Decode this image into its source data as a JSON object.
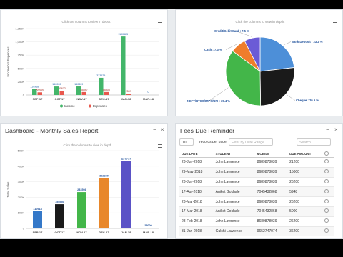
{
  "hint": "Click the columns to view in depth.",
  "income_chart": {
    "chart_data": {
      "type": "bar",
      "categories": [
        "SEP-17",
        "OCT-17",
        "NOV-17",
        "DEC-17",
        "JAN-18",
        "MAR-18"
      ],
      "series": [
        {
          "name": "Income",
          "color": "#43b66a",
          "values": [
            110918,
            160000,
            160809,
            323529,
            1100525,
            0
          ]
        },
        {
          "name": "Expenses",
          "color": "#e8584d",
          "values": [
            50000,
            80672,
            55597,
            55808,
            25000,
            0
          ]
        }
      ],
      "data_labels": {
        "income": [
          "110918",
          "160000",
          "160809",
          "323529",
          "1100525",
          ""
        ],
        "expenses": [
          "50000",
          "80672",
          "55597",
          "55808",
          "250?",
          ""
        ],
        "extra": "0"
      },
      "yticks": [
        "1,250K",
        "1,000K",
        "750K",
        "500K",
        "250K",
        "0"
      ],
      "ylabel": "Income Vs Expenses",
      "xlabel": "",
      "title": ""
    }
  },
  "pie_chart": {
    "chart_data": {
      "type": "pie",
      "slices": [
        {
          "name": "Bank Deposit",
          "value": 23.2,
          "color": "#4d8fd8",
          "label": "Bank Deposit : 23.2 %"
        },
        {
          "name": "Cheque",
          "value": 26.6,
          "color": "#1a1a1a",
          "label": "Cheque : 26.6 %"
        },
        {
          "name": "NEFT/RTGS/IMPS/UPI",
          "value": 35.4,
          "color": "#43b649",
          "label": "NEFT/RTGS/IMPS/UPI : 35.4 %"
        },
        {
          "name": "Cash",
          "value": 7.3,
          "color": "#ef7d2b",
          "label": "Cash : 7.3 %"
        },
        {
          "name": "Credit/Debit Card",
          "value": 7.5,
          "color": "#6b5bd6",
          "label": "Credit/Debit Card : 7.5 %"
        }
      ],
      "title": ""
    }
  },
  "sales_panel": {
    "title": "Dashboard - Monthly Sales Report",
    "minimize": "−",
    "close": "×",
    "chart_data": {
      "type": "bar",
      "categories": [
        "SEP-17",
        "OCT-17",
        "NOV-17",
        "DEC-17",
        "JAN-18",
        "MAR-18"
      ],
      "values": [
        110918,
        155550,
        233508,
        322320,
        432000,
        0
      ],
      "colors": [
        "#3478c8",
        "#1a1a1a",
        "#43b649",
        "#e8872b",
        "#5a52c6",
        "#6a5acd"
      ],
      "data_labels": [
        "110918",
        "155550",
        "233508",
        "322320",
        "4?????",
        "25000"
      ],
      "yticks": [
        "500K",
        "400K",
        "300K",
        "200K",
        "100K",
        "0"
      ],
      "ylabel": "Total Sales",
      "xlabel": "",
      "title": ""
    }
  },
  "fees_panel": {
    "title": "Fees Due Reminder",
    "minimize": "−",
    "close": "×",
    "show_value": "10",
    "records_label": "records per page",
    "filter_placeholder": "Filter by Date Range",
    "search_placeholder": "Search",
    "columns": [
      "DUE DATE",
      "STUDENT",
      "MOBILE",
      "DUE AMOUNT",
      ""
    ],
    "rows": [
      {
        "date": "28-Jun-2018",
        "student": "John Lawrence",
        "mobile": "8689878039",
        "amount": "21200"
      },
      {
        "date": "29-May-2018",
        "student": "John Lawrence",
        "mobile": "8689878039",
        "amount": "15000"
      },
      {
        "date": "28-Jun-2018",
        "student": "John Lawrence",
        "mobile": "8689878039",
        "amount": "26200"
      },
      {
        "date": "17-Apr-2018",
        "student": "Aniket Gokhale",
        "mobile": "7045432868",
        "amount": "5948"
      },
      {
        "date": "28-Mar-2018",
        "student": "John Lawrence",
        "mobile": "8689878039",
        "amount": "26200"
      },
      {
        "date": "17-Mar-2018",
        "student": "Aniket Gokhale",
        "mobile": "7045432868",
        "amount": "5000"
      },
      {
        "date": "28-Feb-2018",
        "student": "John Lawrence",
        "mobile": "8689878039",
        "amount": "26200"
      },
      {
        "date": "31-Jan-2018",
        "student": "Gulshi Lawrence",
        "mobile": "9652747074",
        "amount": "36200"
      }
    ]
  }
}
